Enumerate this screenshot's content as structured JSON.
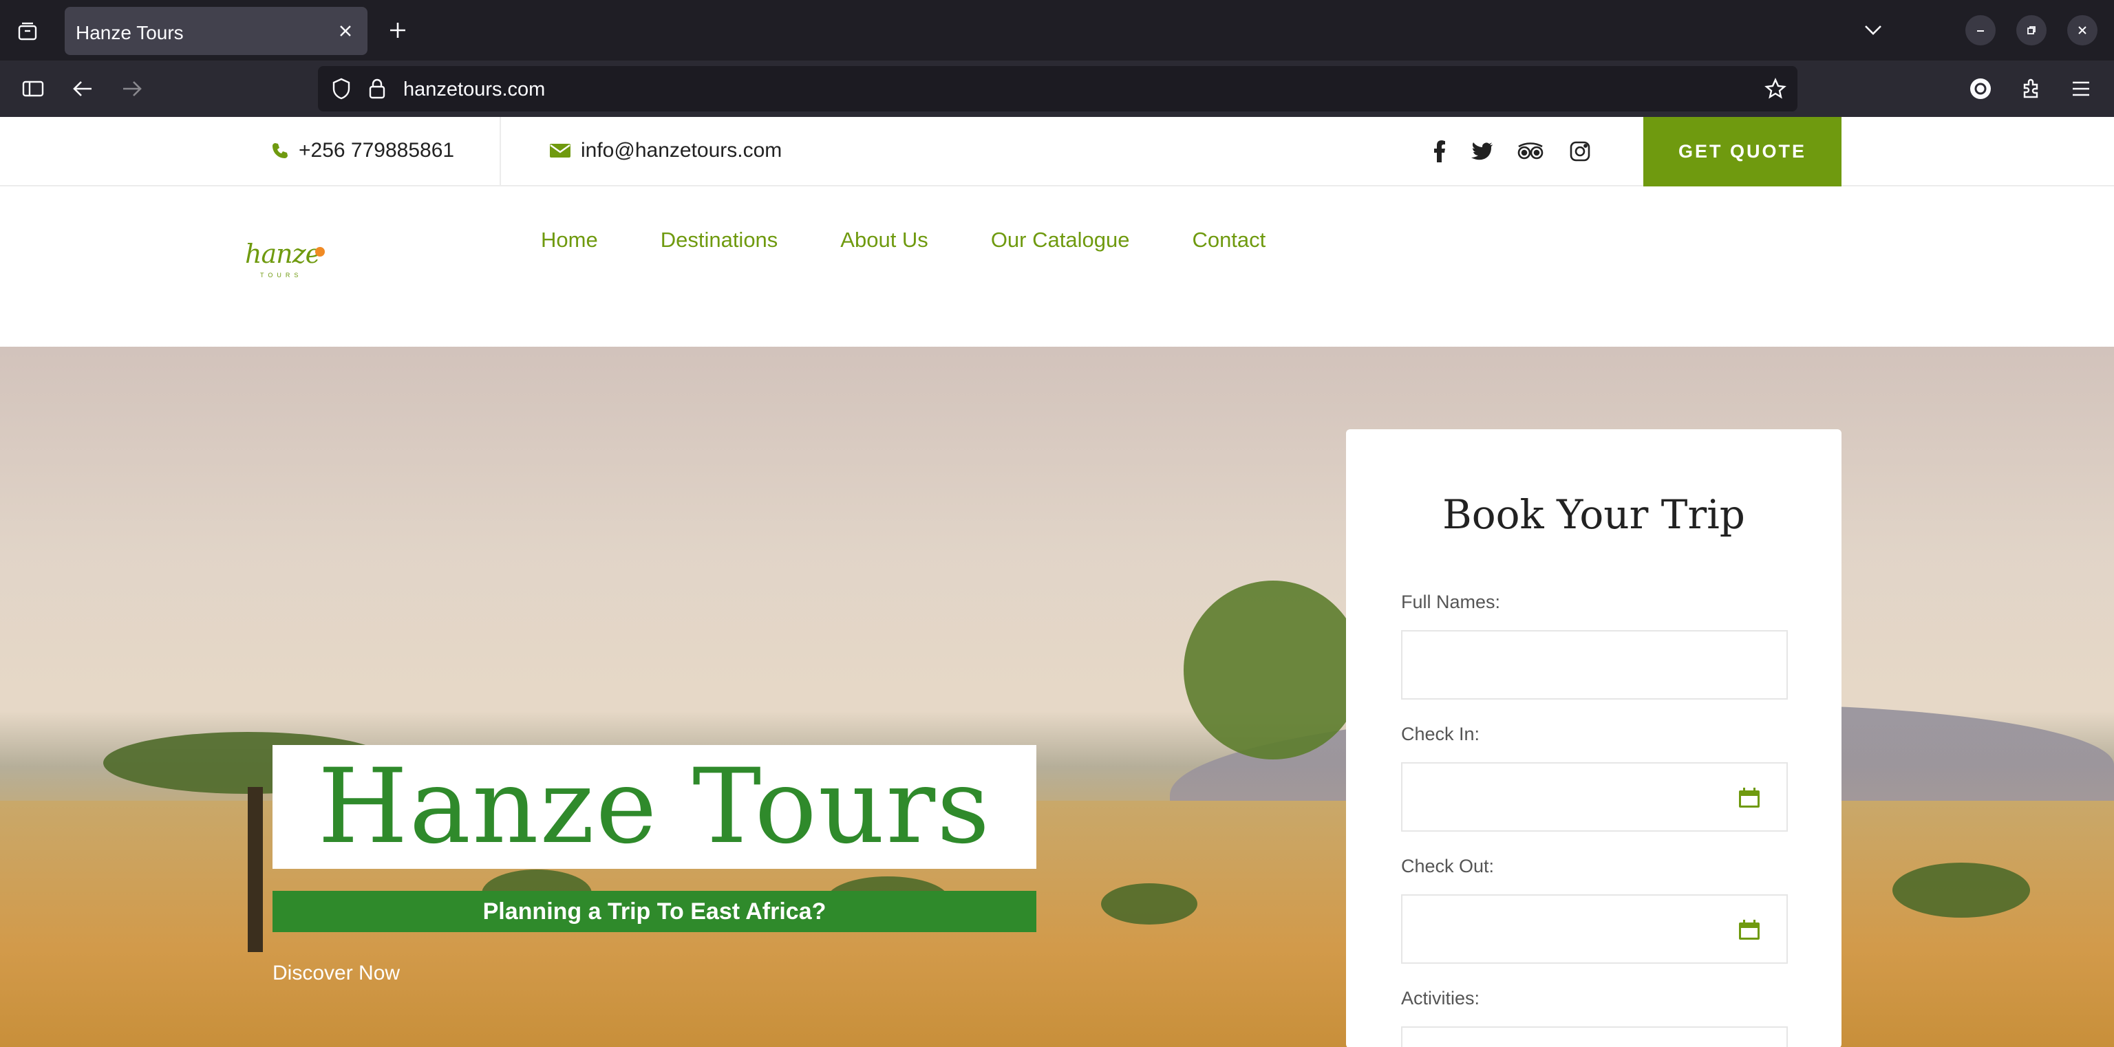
{
  "browser": {
    "tab_title": "Hanze Tours",
    "url": "hanzetours.com"
  },
  "topbar": {
    "phone": "+256 779885861",
    "email": "info@hanzetours.com",
    "quote_label": "GET QUOTE"
  },
  "logo": {
    "text": "hanze",
    "subtext": "TOURS"
  },
  "nav": {
    "items": [
      "Home",
      "Destinations",
      "About Us",
      "Our Catalogue",
      "Contact"
    ]
  },
  "hero": {
    "title": "Hanze Tours",
    "subtitle": "Planning a Trip To East Africa?",
    "cta": "Discover Now"
  },
  "booking": {
    "title": "Book Your Trip",
    "full_names_label": "Full Names:",
    "check_in_label": "Check In:",
    "check_out_label": "Check Out:",
    "activities_label": "Activities:"
  },
  "colors": {
    "brand_green": "#6f9a0f",
    "title_green": "#2f8a2b"
  }
}
